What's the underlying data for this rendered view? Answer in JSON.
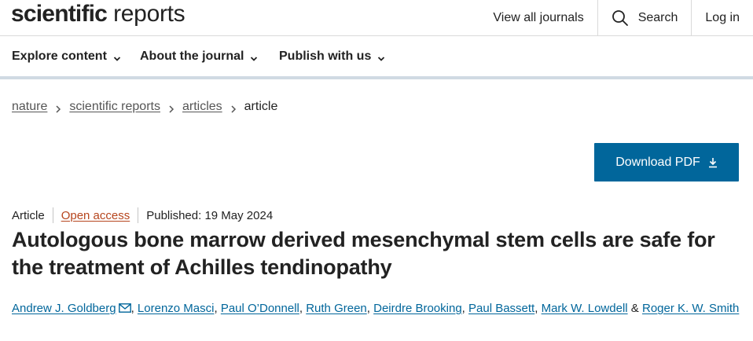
{
  "header": {
    "logo_bold": "scientific",
    "logo_light": "reports",
    "view_all_journals": "View all journals",
    "search_label": "Search",
    "login_label": "Log in"
  },
  "nav": {
    "items": [
      {
        "label": "Explore content"
      },
      {
        "label": "About the journal"
      },
      {
        "label": "Publish with us"
      }
    ]
  },
  "breadcrumb": {
    "items": [
      "nature",
      "scientific reports",
      "articles"
    ],
    "current": "article"
  },
  "download": {
    "label": "Download PDF",
    "color": "#01669b"
  },
  "article": {
    "type": "Article",
    "access": "Open access",
    "published": "Published: 19 May 2024",
    "title": "Autologous bone marrow derived mesenchymal stem cells are safe for the treatment of Achilles tendinopathy",
    "authors": [
      "Andrew J. Goldberg",
      "Lorenzo Masci",
      "Paul O’Donnell",
      "Ruth Green",
      "Deirdre Brooking",
      "Paul Bassett",
      "Mark W. Lowdell",
      "Roger K. W. Smith"
    ],
    "author_separator": ",",
    "author_conjunction": "&"
  },
  "colors": {
    "link": "#01669b",
    "open_access": "#b6451d",
    "nav_border": "#d0dae3"
  }
}
